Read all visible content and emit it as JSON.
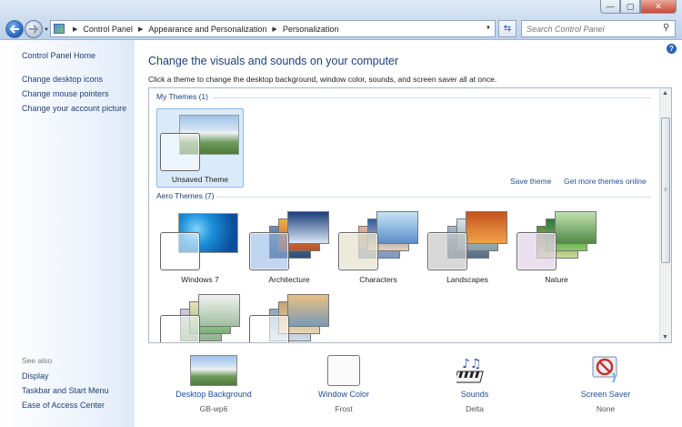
{
  "window": {
    "minimize": "—",
    "maximize": "▢",
    "close": "✕"
  },
  "address": {
    "crumbs": [
      "Control Panel",
      "Appearance and Personalization",
      "Personalization"
    ]
  },
  "search": {
    "placeholder": "Search Control Panel"
  },
  "left": {
    "home": "Control Panel Home",
    "links": [
      "Change desktop icons",
      "Change mouse pointers",
      "Change your account picture"
    ],
    "see_also_title": "See also",
    "see_also": [
      "Display",
      "Taskbar and Start Menu",
      "Ease of Access Center"
    ]
  },
  "main": {
    "heading": "Change the visuals and sounds on your computer",
    "subheading": "Click a theme to change the desktop background, window color, sounds, and screen saver all at once.",
    "my_themes_label": "My Themes (1)",
    "unsaved_theme": "Unsaved Theme",
    "save_theme": "Save theme",
    "get_more": "Get more themes online",
    "aero_label": "Aero Themes (7)",
    "aero_themes": [
      "Windows 7",
      "Architecture",
      "Characters",
      "Landscapes",
      "Nature"
    ]
  },
  "bottom": [
    {
      "title": "Desktop Background",
      "value": "GB-wp6",
      "icon": "desktop-background-icon"
    },
    {
      "title": "Window Color",
      "value": "Frost",
      "icon": "window-color-icon"
    },
    {
      "title": "Sounds",
      "value": "Delta",
      "icon": "sounds-icon"
    },
    {
      "title": "Screen Saver",
      "value": "None",
      "icon": "screen-saver-icon"
    }
  ],
  "colors": {
    "link": "#1e4f98",
    "heading": "#1e3f78",
    "selected_tile": "#d9ebfb"
  }
}
